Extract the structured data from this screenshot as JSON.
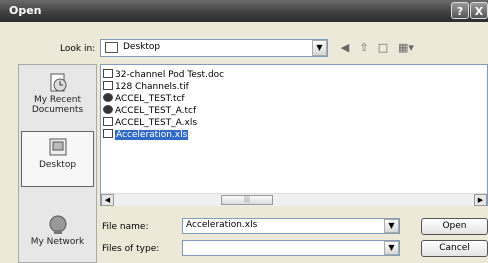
{
  "window": {
    "title": "Open"
  },
  "titlebar": {
    "help_label": "?",
    "close_label": "X"
  },
  "lookin": {
    "label": "Look in:",
    "value": "Desktop"
  },
  "toolbar": {
    "back_icon": "back-icon",
    "up_icon": "up-folder-icon",
    "new_folder_icon": "new-folder-icon",
    "views_icon": "views-menu-icon"
  },
  "places": [
    {
      "label": "My Recent Documents",
      "icon": "recent-documents-icon"
    },
    {
      "label": "Desktop",
      "icon": "desktop-icon"
    },
    {
      "label": "My Network",
      "icon": "network-icon"
    }
  ],
  "files": [
    {
      "name": "32-channel Pod Test.doc",
      "icon": "doc-file-icon"
    },
    {
      "name": "128 Channels.tif",
      "icon": "image-file-icon"
    },
    {
      "name": "ACCEL_TEST.tcf",
      "icon": "tcf-file-icon"
    },
    {
      "name": "ACCEL_TEST_A.tcf",
      "icon": "tcf-file-icon"
    },
    {
      "name": "ACCEL_TEST_A.xls",
      "icon": "xls-file-icon"
    },
    {
      "name": "Acceleration.xls",
      "icon": "xls-file-icon",
      "selected": true
    }
  ],
  "filename": {
    "label": "File name:",
    "value": "Acceleration.xls"
  },
  "filetype": {
    "label": "Files of type:",
    "value": ""
  },
  "buttons": {
    "open": "Open",
    "cancel": "Cancel"
  },
  "colors": {
    "selection": "#316ac5",
    "field_border": "#7f9db9",
    "dialog_bg": "#ece9d8"
  }
}
